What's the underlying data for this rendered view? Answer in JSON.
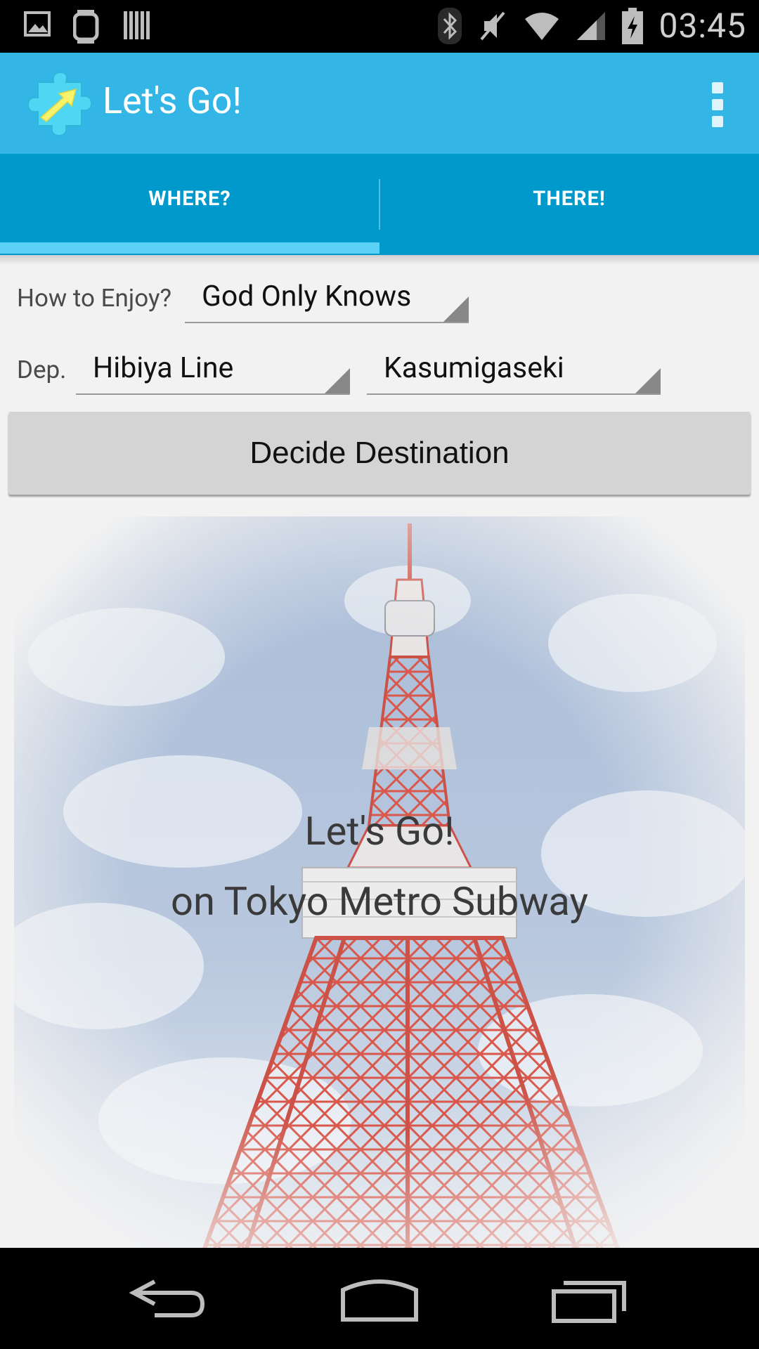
{
  "status_bar": {
    "time": "03:45",
    "left_icons": [
      "image-icon",
      "watch-icon",
      "barcode-icon"
    ],
    "right_icons": [
      "bluetooth-icon",
      "mute-icon",
      "wifi-icon",
      "signal-icon",
      "battery-charging-icon"
    ]
  },
  "action_bar": {
    "title": "Let's Go!",
    "icon": "puzzle-arrow-app-icon",
    "menu_icon": "overflow-menu-icon",
    "color": "#33b5e5"
  },
  "tabs": [
    {
      "label": "WHERE?",
      "selected": true
    },
    {
      "label": "THERE!",
      "selected": false
    }
  ],
  "form": {
    "enjoy_label": "How to Enjoy?",
    "enjoy_value": "God Only Knows",
    "dep_label": "Dep.",
    "line_value": "Hibiya Line",
    "station_value": "Kasumigaseki",
    "decide_button": "Decide Destination"
  },
  "hero": {
    "line1": "Let's Go!",
    "line2": "on Tokyo Metro Subway",
    "image": "tokyo-tower-photo"
  },
  "nav_bar": {
    "buttons": [
      "back-icon",
      "home-icon",
      "recents-icon"
    ]
  }
}
